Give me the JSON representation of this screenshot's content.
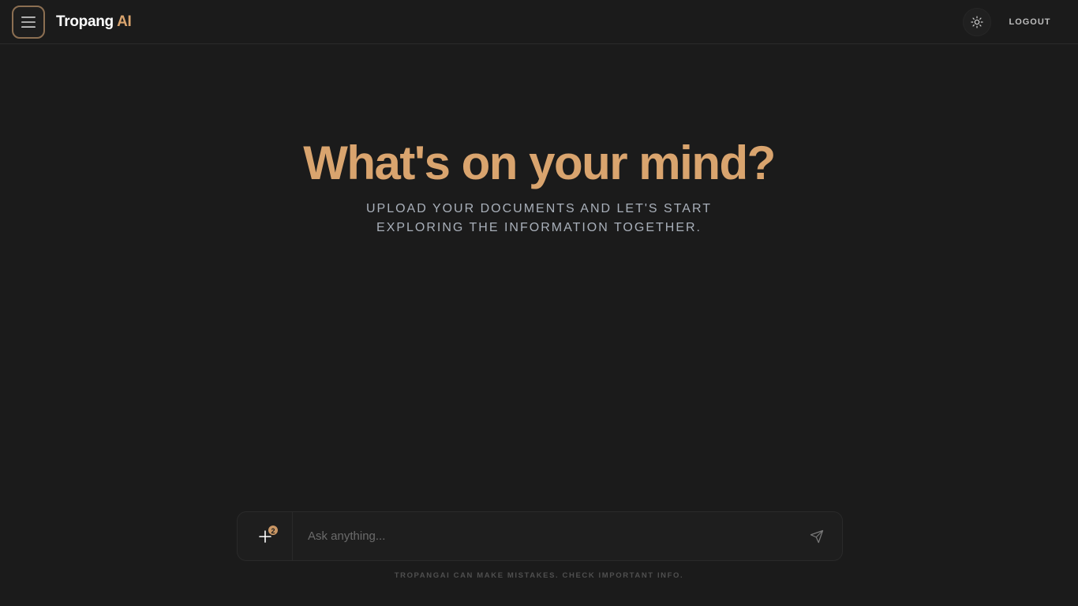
{
  "header": {
    "brand_main": "Tropang",
    "brand_accent": "AI",
    "logout_label": "LOGOUT",
    "menu_icon": "hamburger-icon",
    "theme_icon": "sun-icon"
  },
  "hero": {
    "title": "What's on your mind?",
    "subtitle": "UPLOAD YOUR DOCUMENTS AND LET'S START EXPLORING THE INFORMATION TOGETHER."
  },
  "composer": {
    "placeholder": "Ask anything...",
    "attach_icon": "plus-icon",
    "attach_badge_count": "2",
    "send_icon": "send-icon"
  },
  "footer": {
    "disclaimer": "TROPANGAI CAN MAKE MISTAKES. CHECK IMPORTANT INFO."
  },
  "colors": {
    "background": "#1b1b1b",
    "accent": "#d9a46e",
    "subtitle": "#a9b0ba"
  }
}
